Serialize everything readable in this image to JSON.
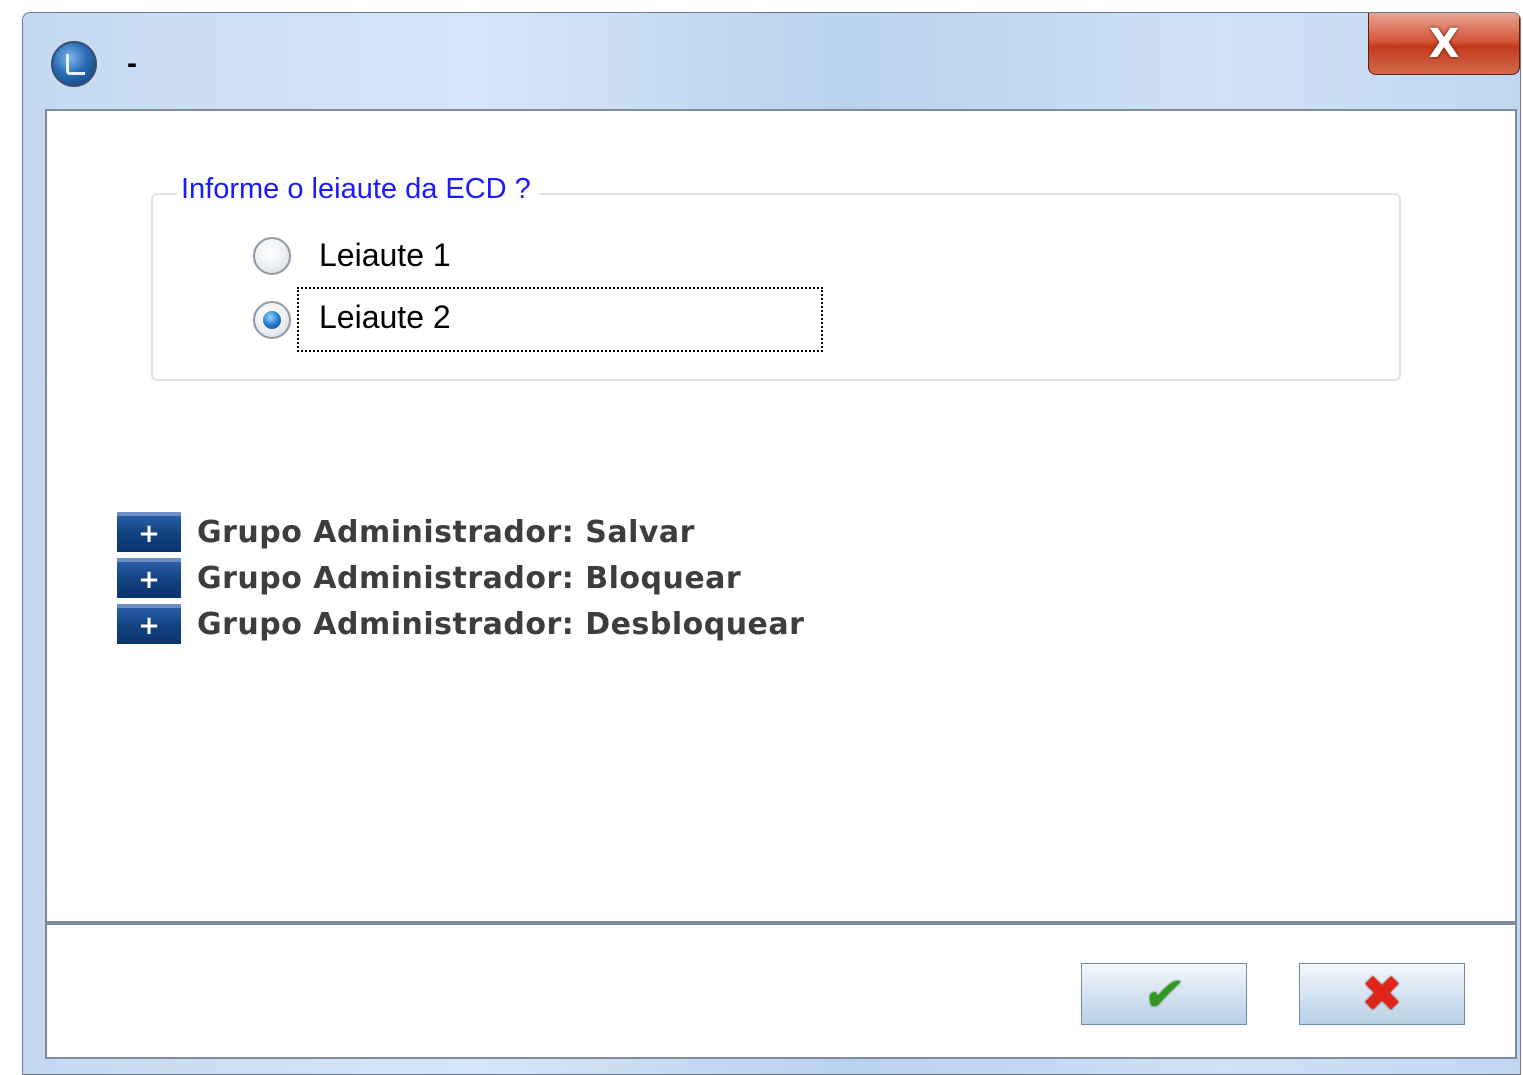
{
  "window": {
    "title": "-",
    "close_symbol": "X",
    "icon": "app-logo-icon"
  },
  "layout_group": {
    "legend": "Informe o leiaute da ECD  ?",
    "options": [
      {
        "label": "Leiaute 1",
        "checked": false
      },
      {
        "label": "Leiaute 2",
        "checked": true
      }
    ]
  },
  "admin_menu": {
    "items": [
      {
        "expand_symbol": "+",
        "label": "Grupo Administrador: Salvar"
      },
      {
        "expand_symbol": "+",
        "label": "Grupo Administrador: Bloquear"
      },
      {
        "expand_symbol": "+",
        "label": "Grupo Administrador: Desbloquear"
      }
    ]
  },
  "footer": {
    "ok_symbol": "✔",
    "cancel_symbol": "✖",
    "ok_icon": "checkmark-icon",
    "cancel_icon": "cancel-x-icon"
  },
  "colors": {
    "legend_text": "#1a1aff",
    "menu_text": "#3d3d3d",
    "plus_box": "#11427f",
    "ok_check": "#2f9a1f",
    "cancel_x": "#e0261a",
    "close_button": "#c23a1c"
  }
}
